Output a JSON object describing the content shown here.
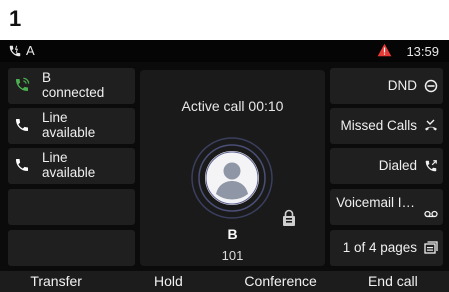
{
  "step_number": "1",
  "status_bar": {
    "line_label": "A",
    "time": "13:59",
    "alert_icon": "warning-triangle-icon",
    "alert_color": "#e53935"
  },
  "line_keys": [
    {
      "line1": "B",
      "line2": "connected",
      "icon": "phone-connected-icon",
      "icon_color": "#4caf50"
    },
    {
      "line1": "Line",
      "line2": "available",
      "icon": "phone-icon",
      "icon_color": "#ffffff"
    },
    {
      "line1": "Line",
      "line2": "available",
      "icon": "phone-icon",
      "icon_color": "#ffffff"
    },
    {
      "line1": "",
      "line2": "",
      "icon": ""
    },
    {
      "line1": "",
      "line2": "",
      "icon": ""
    }
  ],
  "right_keys": [
    {
      "label": "DND",
      "icon": "dnd-icon"
    },
    {
      "label": "Missed Calls",
      "icon": "missed-calls-icon"
    },
    {
      "label": "Dialed",
      "icon": "dialed-call-icon"
    },
    {
      "label": "Voicemail I…",
      "icon": "voicemail-icon"
    },
    {
      "label": "1 of 4 pages",
      "icon": "pages-icon"
    }
  ],
  "call": {
    "title": "Active call 00:10",
    "name": "B",
    "number": "101",
    "security_icon": "encryption-lock-icon"
  },
  "softkeys": [
    "Transfer",
    "Hold",
    "Conference",
    "End call"
  ]
}
